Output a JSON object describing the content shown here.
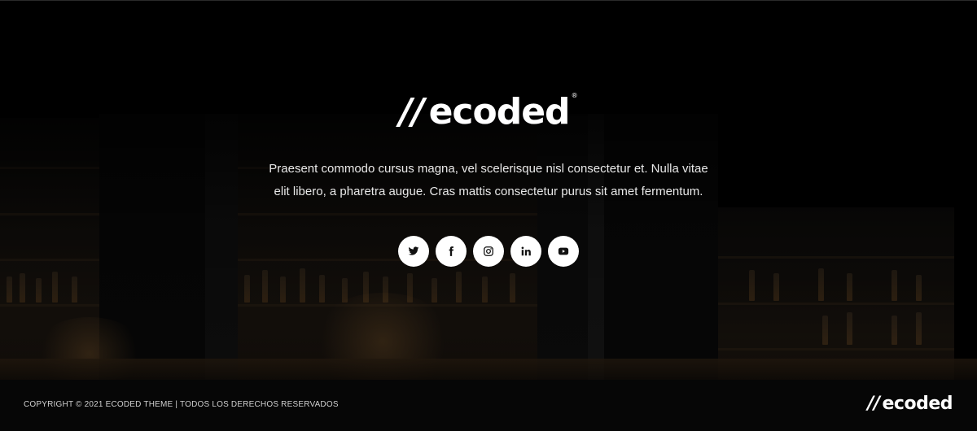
{
  "brand": {
    "name": "ecoded",
    "mark": "//",
    "registered": "®"
  },
  "hero": {
    "description": "Praesent commodo cursus magna, vel scelerisque nisl consectetur et. Nulla vitae elit libero, a pharetra augue. Cras mattis consectetur purus sit amet fermentum."
  },
  "social": [
    {
      "name": "twitter",
      "icon": "twitter-icon"
    },
    {
      "name": "facebook",
      "icon": "facebook-icon"
    },
    {
      "name": "instagram",
      "icon": "instagram-icon"
    },
    {
      "name": "linkedin",
      "icon": "linkedin-icon"
    },
    {
      "name": "youtube",
      "icon": "youtube-icon"
    }
  ],
  "footer": {
    "copyright": "COPYRIGHT © 2021 ECODED THEME | TODOS LOS DERECHOS RESERVADOS"
  },
  "colors": {
    "background": "#000000",
    "text": "#ffffff",
    "social_button": "#ffffff",
    "social_icon": "#111111"
  }
}
